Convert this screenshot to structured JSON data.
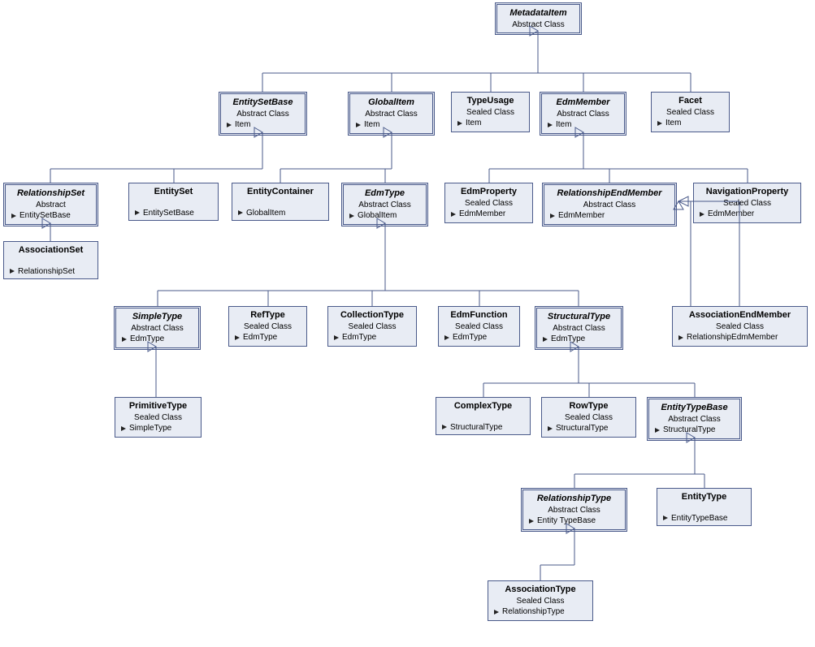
{
  "nodes": {
    "metadataItem": {
      "title": "MetadataItem",
      "type": "Abstract Class",
      "base": ""
    },
    "entitySetBase": {
      "title": "EntitySetBase",
      "type": "Abstract Class",
      "base": "Item"
    },
    "globalItem": {
      "title": "GlobalItem",
      "type": "Abstract Class",
      "base": "Item"
    },
    "typeUsage": {
      "title": "TypeUsage",
      "type": "Sealed Class",
      "base": "Item"
    },
    "edmMember": {
      "title": "EdmMember",
      "type": "Abstract Class",
      "base": "Item"
    },
    "facet": {
      "title": "Facet",
      "type": "Sealed Class",
      "base": "Item"
    },
    "relationshipSet": {
      "title": "RelationshipSet",
      "type": "Abstract",
      "base": "EntitySetBase"
    },
    "entitySet": {
      "title": "EntitySet",
      "type": "",
      "base": "EntitySetBase"
    },
    "entityContainer": {
      "title": "EntityContainer",
      "type": "",
      "base": "GlobalItem"
    },
    "edmType": {
      "title": "EdmType",
      "type": "Abstract Class",
      "base": "GlobalItem"
    },
    "edmProperty": {
      "title": "EdmProperty",
      "type": "Sealed Class",
      "base": "EdmMember"
    },
    "relationshipEndMember": {
      "title": "RelationshipEndMember",
      "type": "Abstract Class",
      "base": "EdmMember"
    },
    "navigationProperty": {
      "title": "NavigationProperty",
      "type": "Sealed Class",
      "base": "EdmMember"
    },
    "associationSet": {
      "title": "AssociationSet",
      "type": "",
      "base": "RelationshipSet"
    },
    "simpleType": {
      "title": "SimpleType",
      "type": "Abstract Class",
      "base": "EdmType"
    },
    "refType": {
      "title": "RefType",
      "type": "Sealed Class",
      "base": "EdmType"
    },
    "collectionType": {
      "title": "CollectionType",
      "type": "Sealed Class",
      "base": "EdmType"
    },
    "edmFunction": {
      "title": "EdmFunction",
      "type": "Sealed Class",
      "base": "EdmType"
    },
    "structuralType": {
      "title": "StructuralType",
      "type": "Abstract Class",
      "base": "EdmType"
    },
    "associationEndMember": {
      "title": "AssociationEndMember",
      "type": "Sealed Class",
      "base": "RelationshipEdmMember"
    },
    "primitiveType": {
      "title": "PrimitiveType",
      "type": "Sealed Class",
      "base": "SimpleType"
    },
    "complexType": {
      "title": "ComplexType",
      "type": "",
      "base": "StructuralType"
    },
    "rowType": {
      "title": "RowType",
      "type": "Sealed Class",
      "base": "StructuralType"
    },
    "entityTypeBase": {
      "title": "EntityTypeBase",
      "type": "Abstract Class",
      "base": "StructuralType"
    },
    "relationshipType": {
      "title": "RelationshipType",
      "type": "Abstract Class",
      "base": "Entity TypeBase"
    },
    "entityType": {
      "title": "EntityType",
      "type": "",
      "base": "EntityTypeBase"
    },
    "associationType": {
      "title": "AssociationType",
      "type": "Sealed Class",
      "base": "RelationshipType"
    }
  }
}
